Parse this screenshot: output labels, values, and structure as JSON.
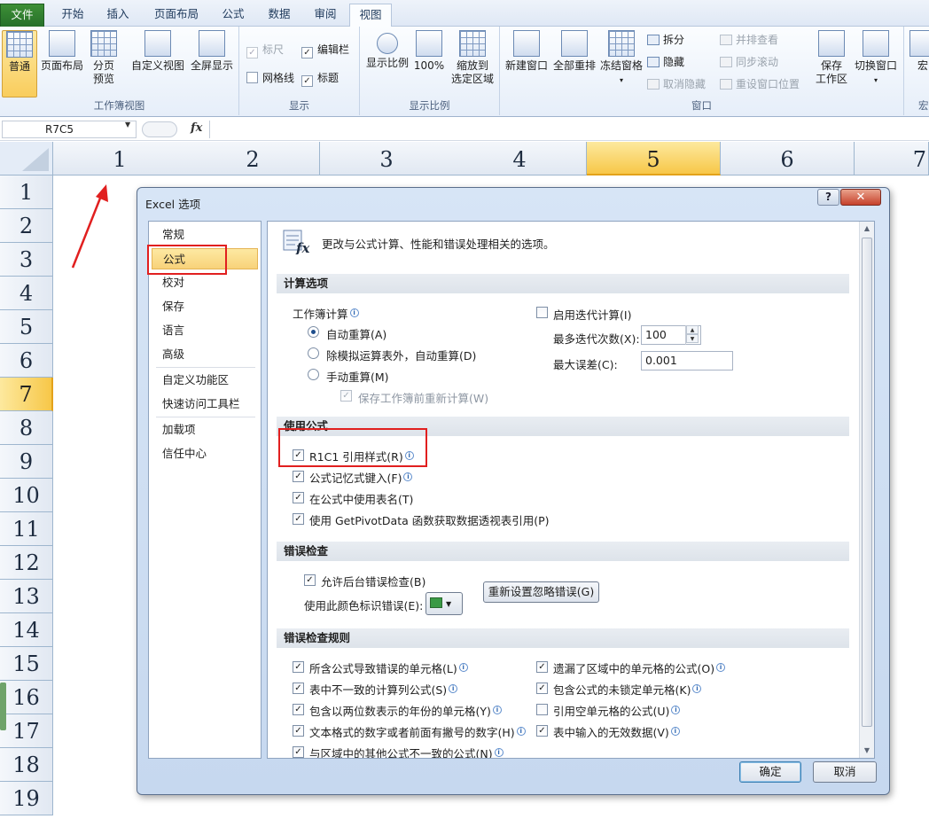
{
  "ribbon_tabs": [
    "文件",
    "开始",
    "插入",
    "页面布局",
    "公式",
    "数据",
    "审阅",
    "视图"
  ],
  "ribbon": {
    "workbook_views": {
      "label": "工作簿视图",
      "normal": "普通",
      "page_layout": "页面布局",
      "page_break_1": "分页",
      "page_break_2": "预览",
      "custom_views": "自定义视图",
      "full_screen": "全屏显示"
    },
    "show": {
      "label": "显示",
      "ruler": "标尺",
      "formula_bar": "编辑栏",
      "gridlines": "网格线",
      "headings": "标题"
    },
    "zoom": {
      "label": "显示比例",
      "zoom": "显示比例",
      "hundred": "100%",
      "zoom_sel_1": "缩放到",
      "zoom_sel_2": "选定区域"
    },
    "window": {
      "label": "窗口",
      "new_window": "新建窗口",
      "arrange_all": "全部重排",
      "freeze": "冻结窗格",
      "split": "拆分",
      "hide": "隐藏",
      "unhide": "取消隐藏",
      "side_by_side": "并排查看",
      "sync_scroll": "同步滚动",
      "reset_pos": "重设窗口位置",
      "save_ws_1": "保存",
      "save_ws_2": "工作区",
      "switch_window": "切换窗口"
    },
    "macros": {
      "label": "宏",
      "macros": "宏"
    }
  },
  "formula_bar": {
    "name_box": "R7C5",
    "fx": "fx",
    "value": ""
  },
  "sheet": {
    "columns": [
      "1",
      "2",
      "3",
      "4",
      "5",
      "6",
      "7"
    ],
    "rows": [
      "1",
      "2",
      "3",
      "4",
      "5",
      "6",
      "7",
      "8",
      "9",
      "10",
      "11",
      "12",
      "13",
      "14",
      "15",
      "16",
      "17",
      "18",
      "19"
    ]
  },
  "dialog": {
    "title": "Excel 选项",
    "help": "?",
    "close": "✕",
    "nav": [
      "常规",
      "公式",
      "校对",
      "保存",
      "语言",
      "高级",
      "自定义功能区",
      "快速访问工具栏",
      "加载项",
      "信任中心"
    ],
    "header": "更改与公式计算、性能和错误处理相关的选项。",
    "calc": {
      "section": "计算选项",
      "workbook_calc": "工作簿计算",
      "auto": "自动重算(A)",
      "auto_except": "除模拟运算表外，自动重算(D)",
      "manual": "手动重算(M)",
      "recalc_before_save": "保存工作簿前重新计算(W)",
      "iterative": "启用迭代计算(I)",
      "max_iter_label": "最多迭代次数(X):",
      "max_iter": "100",
      "max_change_label": "最大误差(C):",
      "max_change": "0.001"
    },
    "formulas": {
      "section": "使用公式",
      "r1c1": "R1C1 引用样式(R)",
      "autocomplete": "公式记忆式键入(F)",
      "table_names": "在公式中使用表名(T)",
      "getpivot": "使用 GetPivotData 函数获取数据透视表引用(P)"
    },
    "errors": {
      "section": "错误检查",
      "background": "允许后台错误检查(B)",
      "color_label": "使用此颜色标识错误(E):",
      "reset_button": "重新设置忽略错误(G)"
    },
    "rules": {
      "section": "错误检查规则",
      "r1": "所含公式导致错误的单元格(L)",
      "r2": "表中不一致的计算列公式(S)",
      "r3": "包含以两位数表示的年份的单元格(Y)",
      "r4": "文本格式的数字或者前面有撇号的数字(H)",
      "r5": "与区域中的其他公式不一致的公式(N)",
      "r6": "遗漏了区域中的单元格的公式(O)",
      "r7": "包含公式的未锁定单元格(K)",
      "r8": "引用空单元格的公式(U)",
      "r9": "表中输入的无效数据(V)"
    },
    "ok": "确定",
    "cancel": "取消"
  }
}
